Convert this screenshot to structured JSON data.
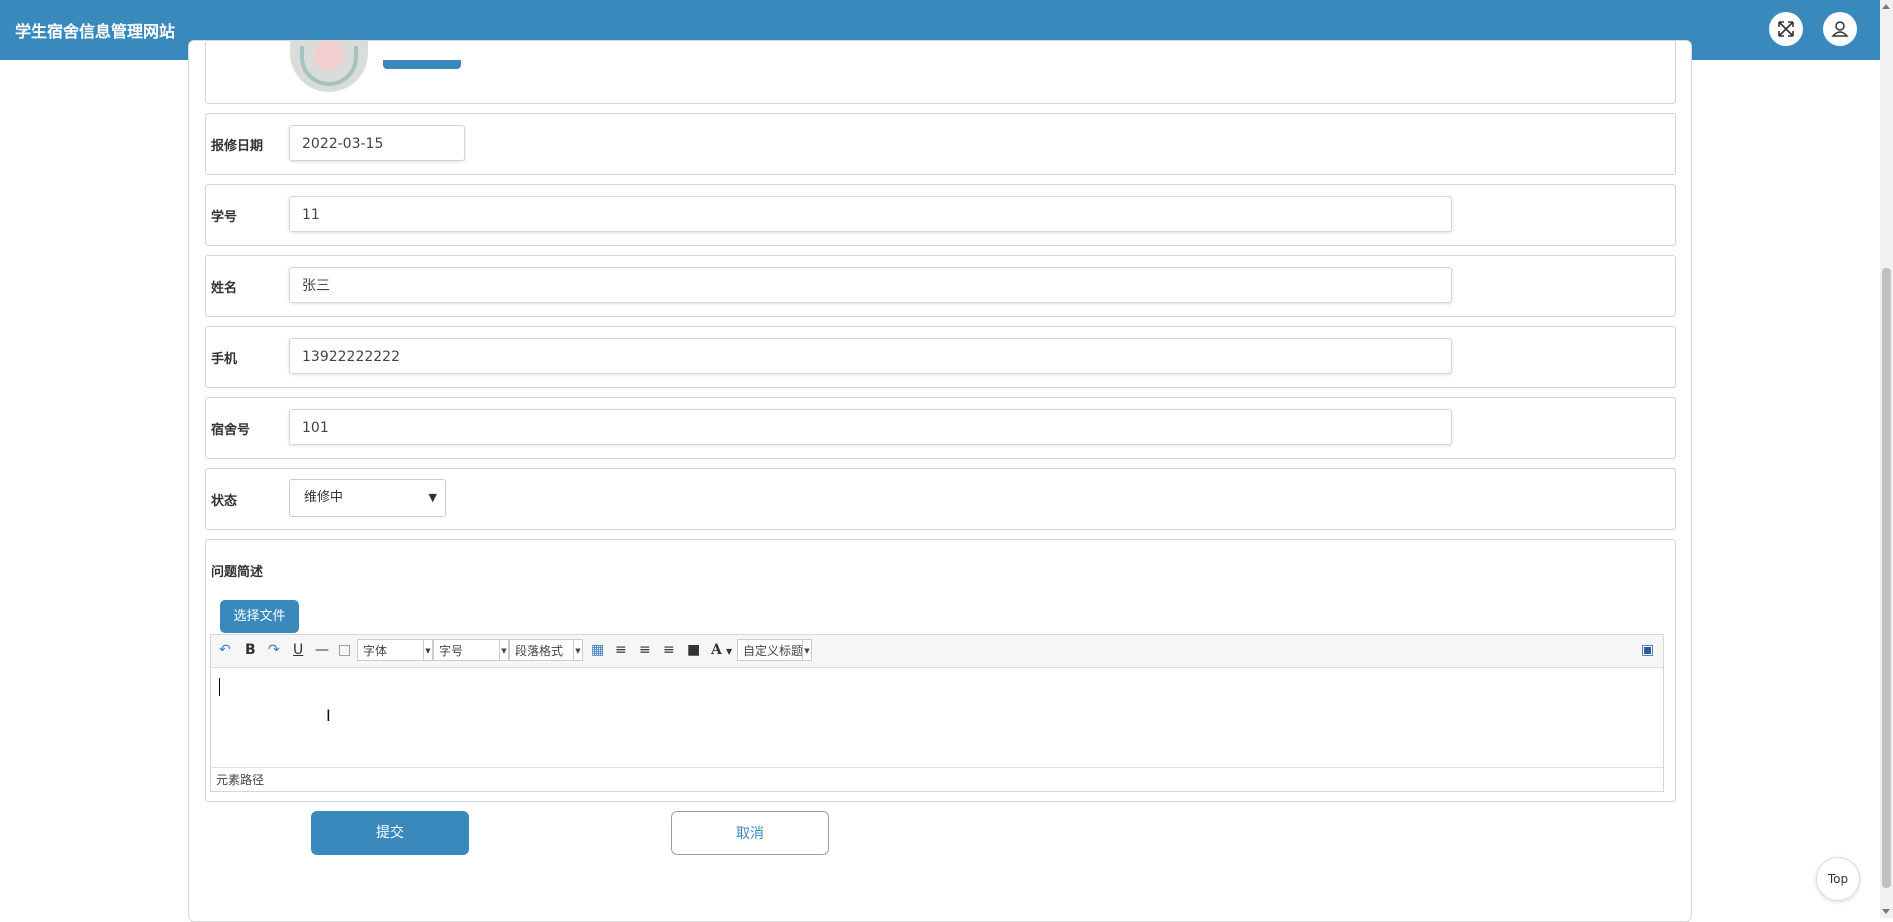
{
  "app": {
    "title": "学生宿舍信息管理网站"
  },
  "header": {
    "fullscreen_icon": "fullscreen-icon",
    "user_icon": "user-icon"
  },
  "form": {
    "fields": [
      {
        "label": "报修日期",
        "value": "2022-03-15"
      },
      {
        "label": "学号",
        "value": "11"
      },
      {
        "label": "姓名",
        "value": "张三"
      },
      {
        "label": "手机",
        "value": "13922222222"
      },
      {
        "label": "宿舍号",
        "value": "101"
      }
    ],
    "status": {
      "label": "状态",
      "value": "维修中"
    },
    "description": {
      "label": "问题简述",
      "file_button": "选择文件",
      "editor": {
        "font_family": "字体",
        "font_size": "字号",
        "paragraph": "段落格式",
        "custom_title": "自定义标题",
        "path_label": "元素路径"
      }
    },
    "submit_label": "提交",
    "cancel_label": "取消"
  },
  "top_button": "Top",
  "colors": {
    "primary": "#3a89bd",
    "border": "#d3d3d3"
  }
}
